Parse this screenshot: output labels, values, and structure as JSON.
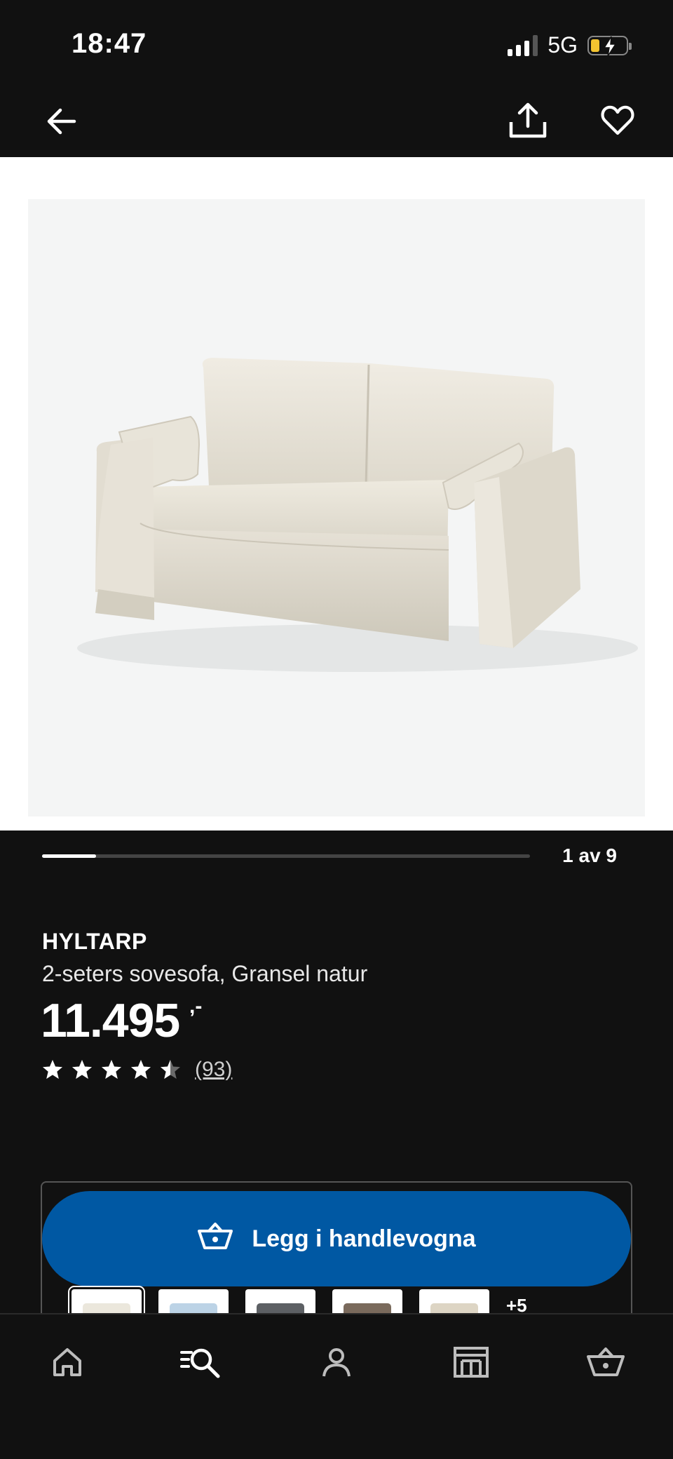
{
  "status_bar": {
    "time": "18:47",
    "network": "5G"
  },
  "top_nav": {
    "back_icon": "arrow-left-icon",
    "share_icon": "share-icon",
    "favorite_icon": "heart-icon"
  },
  "gallery": {
    "counter": "1 av 9",
    "current": 1,
    "total": 9,
    "progress_fraction": 0.11
  },
  "product": {
    "brand": "HYLTARP",
    "description": "2-seters sovesofa, Gransel natur",
    "price": "11.495",
    "price_suffix": ",-",
    "rating": 4.5,
    "review_count": "(93)"
  },
  "cta": {
    "label": "Legg i handlevogna",
    "icon": "shopping-basket-icon",
    "color": "#0058a3"
  },
  "colour_variants": {
    "swatches": [
      {
        "name": "natur",
        "color": "#ebe7dc"
      },
      {
        "name": "lyseblå",
        "color": "#bcd3e6"
      },
      {
        "name": "grå",
        "color": "#5d6064"
      },
      {
        "name": "brun",
        "color": "#7a6a5c"
      },
      {
        "name": "beige",
        "color": "#ddd5c4"
      }
    ],
    "more_label": "+5"
  },
  "bottom_nav": {
    "tabs": [
      {
        "icon": "home-icon"
      },
      {
        "icon": "search-icon"
      },
      {
        "icon": "profile-icon"
      },
      {
        "icon": "store-icon"
      },
      {
        "icon": "basket-icon"
      }
    ]
  }
}
